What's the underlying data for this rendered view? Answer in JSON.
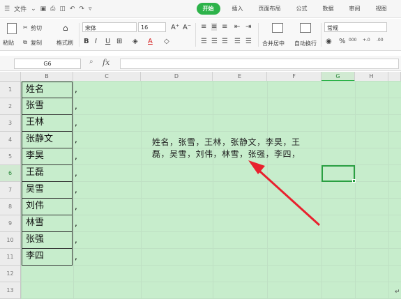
{
  "menubar": {
    "file_label": "文件",
    "tabs": [
      "开始",
      "插入",
      "页面布局",
      "公式",
      "数据",
      "审阅",
      "视图"
    ],
    "active_tab": "开始"
  },
  "ribbon": {
    "paste": "粘贴",
    "cut": "剪切",
    "copy": "复制",
    "format_painter": "格式刷",
    "font_name": "宋体",
    "font_size": "16",
    "grow_font": "A⁺",
    "shrink_font": "A⁻",
    "merge_center": "合并居中",
    "wrap_text": "自动换行",
    "number_format": "常规",
    "percent": "%",
    "thousands": "000",
    "inc_decimal": "+.0",
    "dec_decimal": ".00"
  },
  "formula_bar": {
    "cell_ref": "G6",
    "fx": "fx",
    "formula": ""
  },
  "columns": [
    "B",
    "C",
    "D",
    "E",
    "F",
    "G",
    "H"
  ],
  "selected_column": "G",
  "rows": [
    "1",
    "2",
    "3",
    "4",
    "5",
    "6",
    "7",
    "8",
    "9",
    "10",
    "11",
    "12",
    "13"
  ],
  "selected_row": "6",
  "names": [
    "姓名",
    "张雪",
    "王林",
    "张静文",
    "李昊",
    "王磊",
    "吴雪",
    "刘伟",
    "林雪",
    "张强",
    "李四"
  ],
  "commas": [
    ",",
    ",",
    ",",
    ",",
    ",",
    ",",
    ",",
    ",",
    ",",
    ",",
    ","
  ],
  "textbox": {
    "line1": "姓名，张雪，王林，张静文，李昊，王",
    "line2": "磊，吴雪，刘伟，林雪，张强，李四，"
  },
  "annotation": {
    "arrow_color": "#e8212e"
  },
  "paragraph_mark": "↵"
}
